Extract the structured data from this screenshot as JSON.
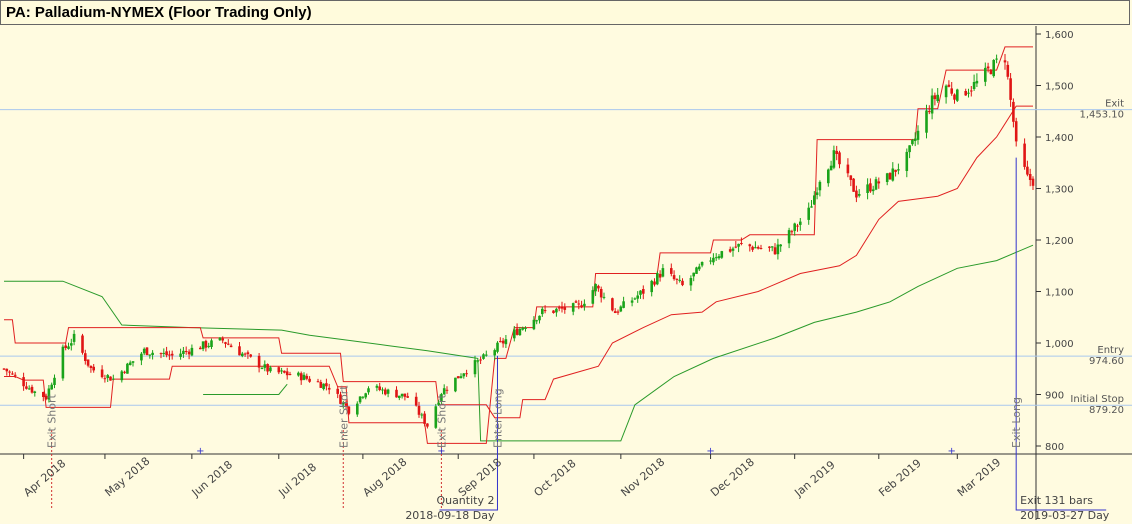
{
  "window": {
    "title": "PA: Palladium-NYMEX (Floor Trading Only)"
  },
  "chart_data": {
    "type": "candlestick",
    "title": "PA: Palladium-NYMEX (Floor Trading Only)",
    "y_axis": {
      "min": 780,
      "max": 1610,
      "ticks": [
        800,
        900,
        1000,
        1100,
        1200,
        1300,
        1400,
        1500,
        1600
      ],
      "tick_labels": [
        "800",
        "900",
        "1,000",
        "1,100",
        "1,200",
        "1,300",
        "1,400",
        "1,500",
        "1,600"
      ],
      "side": "right"
    },
    "x_axis": {
      "months": [
        "Apr 2018",
        "May 2018",
        "Jun 2018",
        "Jul 2018",
        "Aug 2018",
        "Sep 2018",
        "Oct 2018",
        "Nov 2018",
        "Dec 2018",
        "Jan 2019",
        "Feb 2019",
        "Mar 2019"
      ]
    },
    "price_anchors": [
      [
        "2018-03-26",
        950
      ],
      [
        "2018-04-06",
        905
      ],
      [
        "2018-04-10",
        895
      ],
      [
        "2018-04-16",
        985
      ],
      [
        "2018-04-20",
        1010
      ],
      [
        "2018-04-26",
        950
      ],
      [
        "2018-05-04",
        930
      ],
      [
        "2018-05-15",
        985
      ],
      [
        "2018-05-25",
        975
      ],
      [
        "2018-06-05",
        995
      ],
      [
        "2018-06-12",
        1005
      ],
      [
        "2018-06-20",
        975
      ],
      [
        "2018-06-29",
        945
      ],
      [
        "2018-07-10",
        935
      ],
      [
        "2018-07-20",
        915
      ],
      [
        "2018-07-27",
        870
      ],
      [
        "2018-08-03",
        915
      ],
      [
        "2018-08-10",
        905
      ],
      [
        "2018-08-17",
        895
      ],
      [
        "2018-08-24",
        840
      ],
      [
        "2018-08-29",
        905
      ],
      [
        "2018-09-06",
        945
      ],
      [
        "2018-09-13",
        970
      ],
      [
        "2018-09-24",
        1020
      ],
      [
        "2018-10-04",
        1060
      ],
      [
        "2018-10-17",
        1070
      ],
      [
        "2018-10-23",
        1110
      ],
      [
        "2018-10-30",
        1060
      ],
      [
        "2018-11-09",
        1100
      ],
      [
        "2018-11-16",
        1140
      ],
      [
        "2018-11-23",
        1110
      ],
      [
        "2018-12-04",
        1170
      ],
      [
        "2018-12-14",
        1190
      ],
      [
        "2018-12-26",
        1180
      ],
      [
        "2019-01-07",
        1255
      ],
      [
        "2019-01-11",
        1320
      ],
      [
        "2019-01-16",
        1365
      ],
      [
        "2019-01-24",
        1290
      ],
      [
        "2019-02-04",
        1320
      ],
      [
        "2019-02-11",
        1360
      ],
      [
        "2019-02-20",
        1470
      ],
      [
        "2019-02-25",
        1500
      ],
      [
        "2019-03-01",
        1480
      ],
      [
        "2019-03-08",
        1505
      ],
      [
        "2019-03-15",
        1545
      ],
      [
        "2019-03-18",
        1555
      ],
      [
        "2019-03-20",
        1470
      ],
      [
        "2019-03-21",
        1430
      ],
      [
        "2019-03-22",
        1380
      ],
      [
        "2019-03-26",
        1320
      ],
      [
        "2019-03-28",
        1315
      ]
    ],
    "upper_channel": [
      [
        "2018-03-26",
        1045
      ],
      [
        "2018-03-29",
        1045
      ],
      [
        "2018-03-30",
        1000
      ],
      [
        "2018-04-17",
        1000
      ],
      [
        "2018-04-18",
        1030
      ],
      [
        "2018-06-04",
        1030
      ],
      [
        "2018-06-05",
        1010
      ],
      [
        "2018-07-02",
        1010
      ],
      [
        "2018-07-03",
        980
      ],
      [
        "2018-07-24",
        980
      ],
      [
        "2018-07-25",
        925
      ],
      [
        "2018-08-27",
        925
      ],
      [
        "2018-08-28",
        880
      ],
      [
        "2018-09-14",
        880
      ],
      [
        "2018-09-17",
        855
      ],
      [
        "2018-09-26",
        855
      ],
      [
        "2018-09-27",
        890
      ],
      [
        "2018-10-05",
        890
      ],
      [
        "2018-10-08",
        930
      ],
      [
        "2018-10-24",
        955
      ],
      [
        "2018-10-29",
        1000
      ],
      [
        "2018-11-09",
        1030
      ],
      [
        "2018-11-19",
        1055
      ],
      [
        "2018-11-30",
        1060
      ],
      [
        "2018-12-05",
        1080
      ],
      [
        "2018-12-20",
        1100
      ],
      [
        "2019-01-04",
        1135
      ],
      [
        "2019-01-18",
        1150
      ],
      [
        "2019-01-24",
        1170
      ],
      [
        "2019-02-01",
        1240
      ],
      [
        "2019-02-08",
        1275
      ],
      [
        "2019-02-22",
        1285
      ],
      [
        "2019-03-01",
        1300
      ],
      [
        "2019-03-08",
        1360
      ],
      [
        "2019-03-15",
        1400
      ],
      [
        "2019-03-22",
        1460
      ],
      [
        "2019-03-28",
        1460
      ]
    ],
    "breakout_channel": [
      [
        "2018-03-26",
        935
      ],
      [
        "2018-03-30",
        935
      ],
      [
        "2018-04-02",
        928
      ],
      [
        "2018-04-09",
        928
      ],
      [
        "2018-04-10",
        875
      ],
      [
        "2018-05-03",
        875
      ],
      [
        "2018-05-04",
        930
      ],
      [
        "2018-05-24",
        930
      ],
      [
        "2018-05-25",
        955
      ],
      [
        "2018-07-20",
        955
      ],
      [
        "2018-07-23",
        915
      ],
      [
        "2018-07-26",
        915
      ],
      [
        "2018-07-27",
        845
      ],
      [
        "2018-08-23",
        845
      ],
      [
        "2018-08-24",
        805
      ],
      [
        "2018-09-14",
        805
      ],
      [
        "2018-09-17",
        970
      ],
      [
        "2018-09-21",
        970
      ],
      [
        "2018-09-24",
        1030
      ],
      [
        "2018-10-01",
        1030
      ],
      [
        "2018-10-02",
        1070
      ],
      [
        "2018-10-22",
        1070
      ],
      [
        "2018-10-23",
        1135
      ],
      [
        "2018-11-14",
        1135
      ],
      [
        "2018-11-15",
        1175
      ],
      [
        "2018-12-03",
        1175
      ],
      [
        "2018-12-04",
        1200
      ],
      [
        "2018-12-14",
        1200
      ],
      [
        "2018-12-17",
        1210
      ],
      [
        "2019-01-09",
        1210
      ],
      [
        "2019-01-10",
        1395
      ],
      [
        "2019-02-14",
        1395
      ],
      [
        "2019-02-15",
        1455
      ],
      [
        "2019-02-22",
        1455
      ],
      [
        "2019-02-25",
        1530
      ],
      [
        "2019-03-15",
        1530
      ],
      [
        "2019-03-18",
        1575
      ],
      [
        "2019-03-28",
        1575
      ]
    ],
    "green_trail": [
      [
        "2018-03-26",
        1120
      ],
      [
        "2018-04-16",
        1120
      ],
      [
        "2018-04-30",
        1090
      ],
      [
        "2018-05-07",
        1035
      ],
      [
        "2018-06-01",
        1030
      ],
      [
        "2018-07-03",
        1025
      ],
      [
        "2018-07-13",
        1015
      ],
      [
        "2018-07-27",
        1005
      ],
      [
        "2018-08-10",
        995
      ],
      [
        "2018-08-24",
        985
      ],
      [
        "2018-09-05",
        975
      ],
      [
        "2018-09-11",
        970
      ],
      [
        "2018-09-12",
        810
      ],
      [
        "2018-11-01",
        810
      ],
      [
        "2018-11-06",
        880
      ],
      [
        "2018-11-20",
        935
      ],
      [
        "2018-12-04",
        970
      ],
      [
        "2018-12-26",
        1010
      ],
      [
        "2019-01-09",
        1040
      ],
      [
        "2019-01-24",
        1060
      ],
      [
        "2019-02-05",
        1080
      ],
      [
        "2019-02-15",
        1110
      ],
      [
        "2019-03-01",
        1145
      ],
      [
        "2019-03-15",
        1160
      ],
      [
        "2019-03-28",
        1190
      ]
    ],
    "green_early_segment": [
      [
        "2018-06-05",
        900
      ],
      [
        "2018-07-02",
        900
      ],
      [
        "2018-07-05",
        920
      ]
    ],
    "levels": [
      {
        "label": "Exit",
        "value": 1453.1,
        "value_text": "1,453.10"
      },
      {
        "label": "Entry",
        "value": 974.6,
        "value_text": "974.60"
      },
      {
        "label": "Initial Stop",
        "value": 879.2,
        "value_text": "879.20"
      }
    ],
    "signals": [
      {
        "label": "Exit Short",
        "date": "2018-04-12"
      },
      {
        "label": "Enter Short",
        "date": "2018-07-25"
      },
      {
        "label": "Exit Short",
        "date": "2018-08-29"
      },
      {
        "label": "Enter Long",
        "date": "2018-09-18"
      },
      {
        "label": "Exit Long",
        "date": "2019-03-22"
      }
    ],
    "trade": {
      "entry_quantity": "Quantity 2",
      "entry_date": "2018-09-18 Day",
      "exit_bars": "Exit 131 bars",
      "exit_date": "2019-03-27 Day"
    },
    "marker_dates": [
      "2018-06-04",
      "2018-08-29",
      "2018-12-03",
      "2019-02-27"
    ]
  }
}
